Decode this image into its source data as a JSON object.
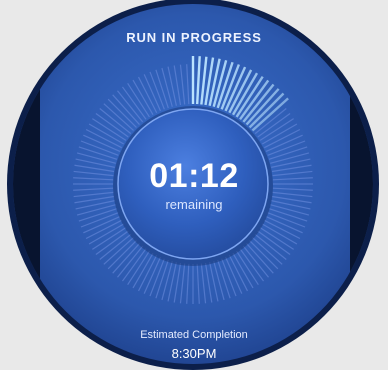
{
  "screen": {
    "title": "RUN IN PROGRESS",
    "timer": {
      "value": "01:12",
      "caption": "remaining",
      "progress_fraction": 0.14
    },
    "estimated": {
      "label": "Estimated Completion",
      "time": "8:30PM"
    }
  },
  "colors": {
    "dial_background": "#2c58ad",
    "bezel": "#0b1a3d",
    "tick_idle": "#6f8fe0",
    "tick_progress": "#b9e2ff",
    "page_background": "#e9e9e9"
  },
  "icons": {
    "progress_ring": "radial-tick-progress-ring"
  }
}
